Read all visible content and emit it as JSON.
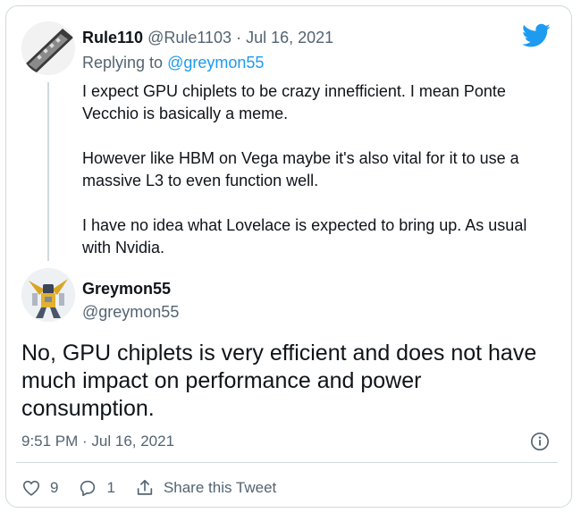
{
  "parent": {
    "name": "Rule110",
    "handle": "@Rule1103",
    "date": "Jul 16, 2021",
    "separator": "·",
    "replying_label": "Replying to",
    "replying_to": "@greymon55",
    "paragraphs": [
      "I expect GPU chiplets to be crazy innefficient. I mean Ponte Vecchio is basically a meme.",
      "However like HBM on Vega maybe it's also vital for it to use a massive L3 to even function well.",
      "I have no idea what Lovelace is expected to bring up. As usual with Nvidia."
    ]
  },
  "tweet": {
    "name": "Greymon55",
    "handle": "@greymon55",
    "text": "No, GPU chiplets is very efficient and does not have much impact on performance and power consumption.",
    "timestamp": "9:51 PM · Jul 16, 2021",
    "likes": "9",
    "replies": "1",
    "share_label": "Share this Tweet"
  },
  "icons": {
    "brand": "twitter-bird-icon",
    "info": "info-icon",
    "like": "heart-icon",
    "reply": "reply-icon",
    "share": "share-icon"
  },
  "colors": {
    "brand": "#1d9bf0",
    "secondary_text": "#536471",
    "border": "#cfd9de"
  }
}
